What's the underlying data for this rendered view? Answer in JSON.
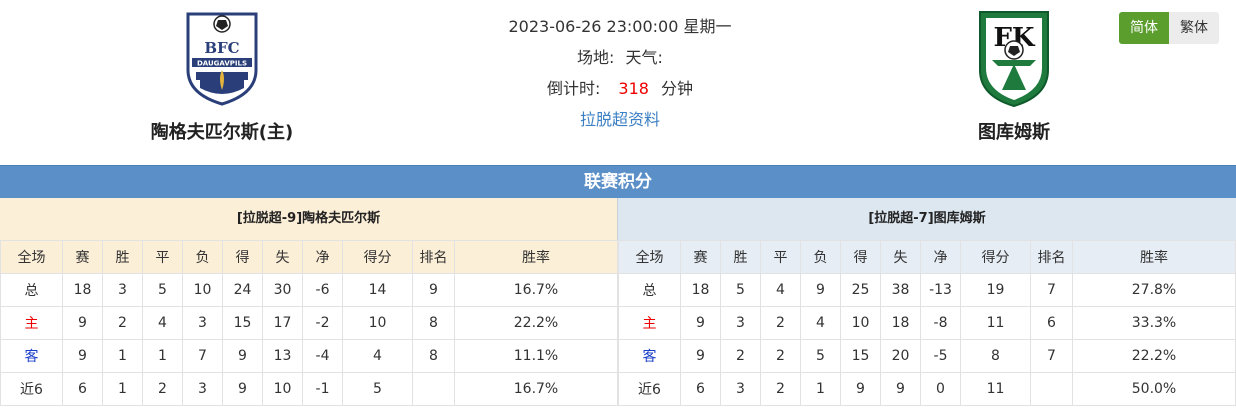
{
  "header": {
    "datetime": "2023-06-26 23:00:00 星期一",
    "venue_label": "场地:",
    "weather_label": "天气:",
    "countdown_label": "倒计时:",
    "countdown_value": "318",
    "countdown_unit": "分钟",
    "league_link": "拉脱超资料"
  },
  "home": {
    "name": "陶格夫匹尔斯(主)",
    "logo_text_1": "BFC",
    "logo_text_2": "DAUGAVPILS"
  },
  "away": {
    "name": "图库姆斯",
    "logo_text": "FK"
  },
  "lang": {
    "simplified": "简体",
    "traditional": "繁体"
  },
  "section_title": "联赛积分",
  "columns": [
    "全场",
    "赛",
    "胜",
    "平",
    "负",
    "得",
    "失",
    "净",
    "得分",
    "排名",
    "胜率"
  ],
  "left_table": {
    "title": "[拉脱超-9]陶格夫匹尔斯",
    "rows": [
      [
        "总",
        "18",
        "3",
        "5",
        "10",
        "24",
        "30",
        "-6",
        "14",
        "9",
        "16.7%"
      ],
      [
        "主",
        "9",
        "2",
        "4",
        "3",
        "15",
        "17",
        "-2",
        "10",
        "8",
        "22.2%"
      ],
      [
        "客",
        "9",
        "1",
        "1",
        "7",
        "9",
        "13",
        "-4",
        "4",
        "8",
        "11.1%"
      ],
      [
        "近6",
        "6",
        "1",
        "2",
        "3",
        "9",
        "10",
        "-1",
        "5",
        "",
        "16.7%"
      ]
    ]
  },
  "right_table": {
    "title": "[拉脱超-7]图库姆斯",
    "rows": [
      [
        "总",
        "18",
        "5",
        "4",
        "9",
        "25",
        "38",
        "-13",
        "19",
        "7",
        "27.8%"
      ],
      [
        "主",
        "9",
        "3",
        "2",
        "4",
        "10",
        "18",
        "-8",
        "11",
        "6",
        "33.3%"
      ],
      [
        "客",
        "9",
        "2",
        "2",
        "5",
        "15",
        "20",
        "-5",
        "8",
        "7",
        "22.2%"
      ],
      [
        "近6",
        "6",
        "3",
        "2",
        "1",
        "9",
        "9",
        "0",
        "11",
        "",
        "50.0%"
      ]
    ]
  },
  "colors": {
    "header_bar": "#5a8fc8",
    "home_bg": "#fcefd8",
    "away_bg": "#dde7f0",
    "accent_red": "#e00000",
    "accent_blue": "#1a3fc8",
    "lang_active": "#5b9e2e"
  }
}
